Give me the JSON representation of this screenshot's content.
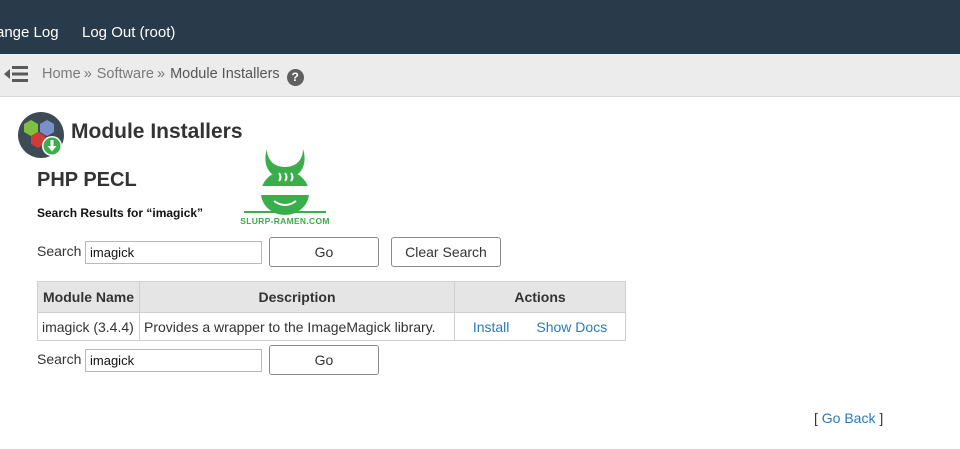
{
  "topbar": {
    "links": [
      {
        "label": "ange Log"
      },
      {
        "label": "Log Out (root)"
      }
    ]
  },
  "breadcrumb": {
    "home": "Home",
    "separator": "»",
    "software": "Software",
    "current": "Module Installers",
    "help_glyph": "?"
  },
  "page": {
    "title": "Module Installers",
    "section_title": "PHP PECL",
    "results_caption": "Search Results for “imagick”"
  },
  "watermark": {
    "text": "SLURP-RAMEN.COM"
  },
  "search_top": {
    "label": "Search",
    "value": "imagick",
    "go_label": "Go",
    "clear_label": "Clear Search"
  },
  "table": {
    "headers": {
      "module_name": "Module Name",
      "description": "Description",
      "actions": "Actions"
    },
    "rows": [
      {
        "module": "imagick (3.4.4)",
        "description": "Provides a wrapper to the ImageMagick library.",
        "install": "Install",
        "show_docs": "Show Docs"
      }
    ]
  },
  "search_bottom": {
    "label": "Search",
    "value": "imagick",
    "go_label": "Go"
  },
  "footer": {
    "open_bracket": "[",
    "go_back": "Go Back",
    "close_bracket": "]"
  },
  "icons": {
    "menu": "hamburger-menu-icon",
    "help": "question-circle-icon",
    "page": "module-installers-icon",
    "watermark": "ninja-mascot-logo"
  },
  "colors": {
    "topbar": "#293a4a",
    "link": "#2a7ab8",
    "watermark_green": "#3aae4a"
  }
}
